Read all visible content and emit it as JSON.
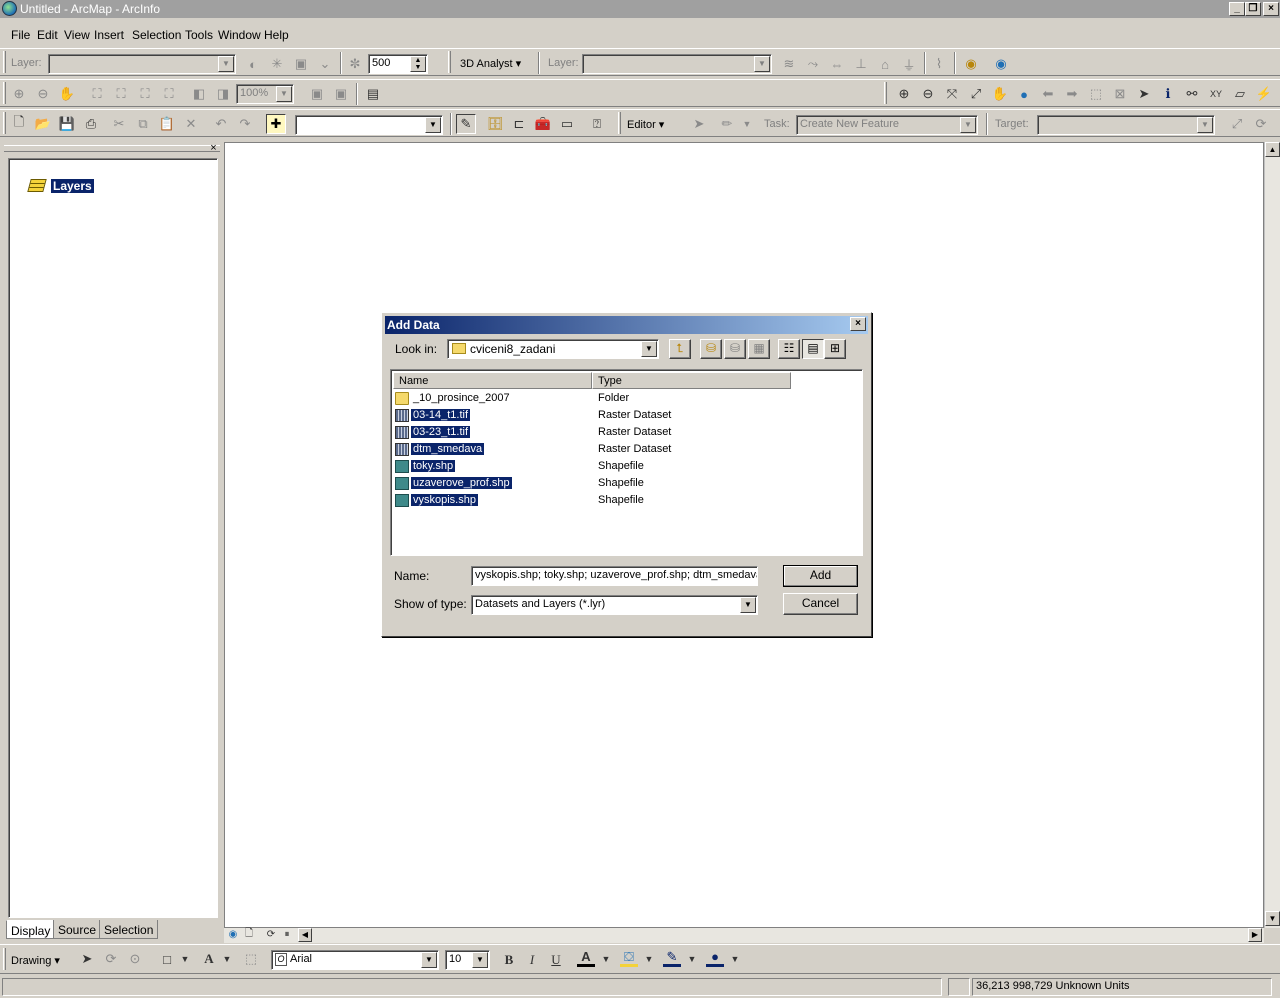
{
  "window": {
    "title": "Untitled - ArcMap - ArcInfo"
  },
  "menu": [
    "File",
    "Edit",
    "View",
    "Insert",
    "Selection",
    "Tools",
    "Window",
    "Help"
  ],
  "toolbar_3d": {
    "layer_label": "Layer:",
    "scale_value": "500",
    "analyst_label": "3D Analyst",
    "layer2_label": "Layer:"
  },
  "toolbar_layout": {
    "zoom_percent": "100%"
  },
  "toolbar_editor": {
    "editor_label": "Editor",
    "task_label": "Task:",
    "task_value": "Create New Feature",
    "target_label": "Target:"
  },
  "toc": {
    "root_label": "Layers",
    "tabs": [
      "Display",
      "Source",
      "Selection"
    ]
  },
  "dialog": {
    "title": "Add Data",
    "look_in_label": "Look in:",
    "look_in_value": "cviceni8_zadani",
    "columns": [
      "Name",
      "Type"
    ],
    "files": [
      {
        "name": "_10_prosince_2007",
        "type": "Folder",
        "icon": "folder-icon",
        "selected": false
      },
      {
        "name": "03-14_t1.tif",
        "type": "Raster Dataset",
        "icon": "raster-icon",
        "selected": true
      },
      {
        "name": "03-23_t1.tif",
        "type": "Raster Dataset",
        "icon": "raster-icon",
        "selected": true
      },
      {
        "name": "dtm_smedava",
        "type": "Raster Dataset",
        "icon": "raster-icon",
        "selected": true
      },
      {
        "name": "toky.shp",
        "type": "Shapefile",
        "icon": "line-shapefile-icon",
        "selected": true
      },
      {
        "name": "uzaverove_prof.shp",
        "type": "Shapefile",
        "icon": "point-shapefile-icon",
        "selected": true
      },
      {
        "name": "vyskopis.shp",
        "type": "Shapefile",
        "icon": "line-shapefile-icon",
        "selected": true
      }
    ],
    "name_label": "Name:",
    "name_value": "vyskopis.shp; toky.shp; uzaverove_prof.shp; dtm_smedava;",
    "type_label": "Show of type:",
    "type_value": "Datasets and Layers (*.lyr)",
    "add_label": "Add",
    "cancel_label": "Cancel"
  },
  "drawing": {
    "drawing_label": "Drawing",
    "font_value": "Arial",
    "size_value": "10",
    "bold": "B",
    "italic": "I",
    "underline": "U",
    "font_color_glyph": "A"
  },
  "status": {
    "coordinates": "36,213  998,729 Unknown Units"
  }
}
